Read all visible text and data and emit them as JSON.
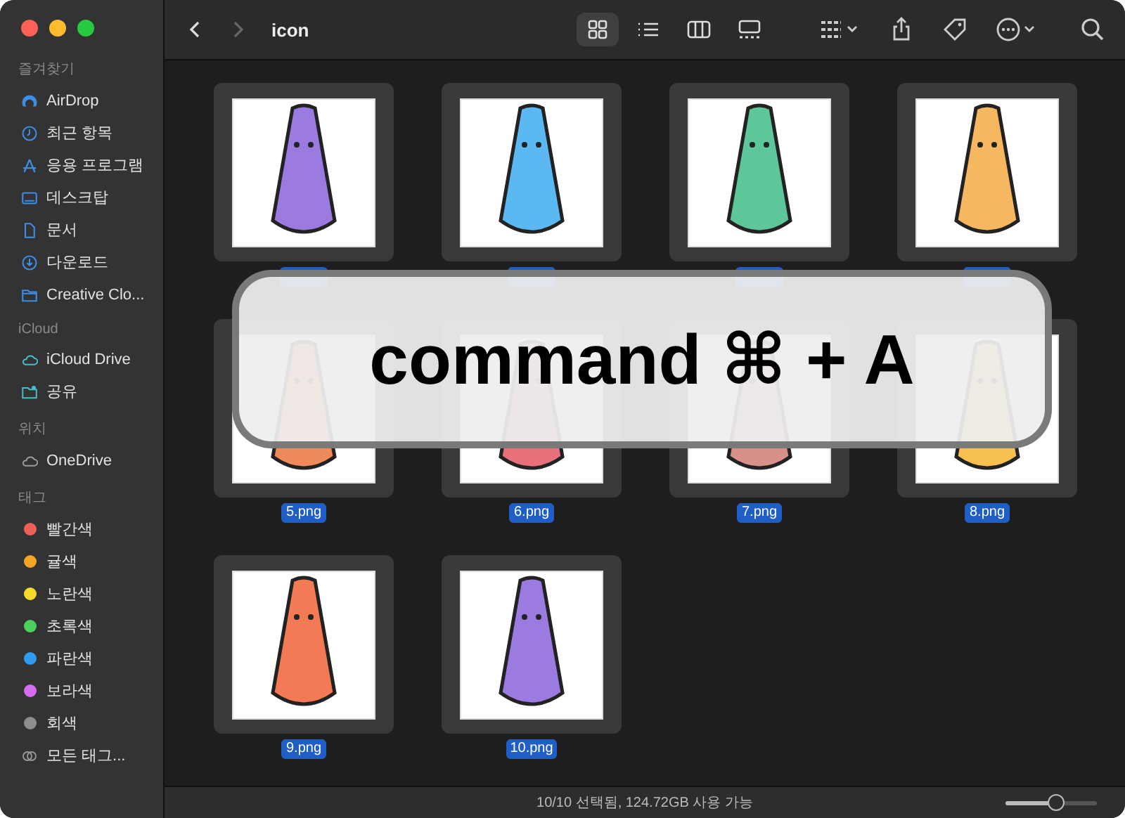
{
  "window": {
    "title": "icon"
  },
  "sidebar": {
    "sections": [
      {
        "heading": "즐겨찾기",
        "items": [
          {
            "kind": "airdrop",
            "label": "AirDrop"
          },
          {
            "kind": "clock",
            "label": "최근 항목"
          },
          {
            "kind": "apps",
            "label": "응용 프로그램"
          },
          {
            "kind": "desktop",
            "label": "데스크탑"
          },
          {
            "kind": "document",
            "label": "문서"
          },
          {
            "kind": "download",
            "label": "다운로드"
          },
          {
            "kind": "folder",
            "label": "Creative Clo..."
          }
        ]
      },
      {
        "heading": "iCloud",
        "items": [
          {
            "kind": "cloud",
            "label": "iCloud Drive"
          },
          {
            "kind": "shared",
            "label": "공유"
          }
        ]
      },
      {
        "heading": "위치",
        "items": [
          {
            "kind": "cloud-grey",
            "label": "OneDrive"
          }
        ]
      },
      {
        "heading": "태그",
        "items": [
          {
            "kind": "tag",
            "label": "빨간색",
            "color": "#ee5f58"
          },
          {
            "kind": "tag",
            "label": "귤색",
            "color": "#f6a528"
          },
          {
            "kind": "tag",
            "label": "노란색",
            "color": "#f5dc2a"
          },
          {
            "kind": "tag",
            "label": "초록색",
            "color": "#4cd15c"
          },
          {
            "kind": "tag",
            "label": "파란색",
            "color": "#2f9cf0"
          },
          {
            "kind": "tag",
            "label": "보라색",
            "color": "#d66cf0"
          },
          {
            "kind": "tag",
            "label": "회색",
            "color": "#8e8e8e"
          },
          {
            "kind": "all-tags",
            "label": "모든 태그..."
          }
        ]
      }
    ]
  },
  "view_modes": [
    {
      "kind": "icons",
      "selected": true
    },
    {
      "kind": "list",
      "selected": false
    },
    {
      "kind": "columns",
      "selected": false
    },
    {
      "kind": "gallery",
      "selected": false
    }
  ],
  "files": [
    {
      "color": "#9b7be0",
      "selected": true
    },
    {
      "color": "#5cb8f0",
      "selected": true
    },
    {
      "color": "#5ec79a",
      "selected": true
    },
    {
      "color": "#f5b860",
      "selected": true
    },
    {
      "label": "5.png",
      "color": "#f08a5a",
      "selected": true
    },
    {
      "label": "6.png",
      "color": "#e8707a",
      "selected": true
    },
    {
      "label": "7.png",
      "color": "#d89088",
      "selected": true
    },
    {
      "label": "8.png",
      "color": "#f7c050",
      "selected": true
    },
    {
      "label": "9.png",
      "color": "#f27a55",
      "selected": true
    },
    {
      "label": "10.png",
      "color": "#9b7be0",
      "selected": true
    }
  ],
  "overlay": {
    "text": "command ⌘ + A"
  },
  "status_bar": {
    "text": "10/10 선택됨, 124.72GB 사용 가능",
    "zoom": {
      "level": 0.55
    }
  }
}
